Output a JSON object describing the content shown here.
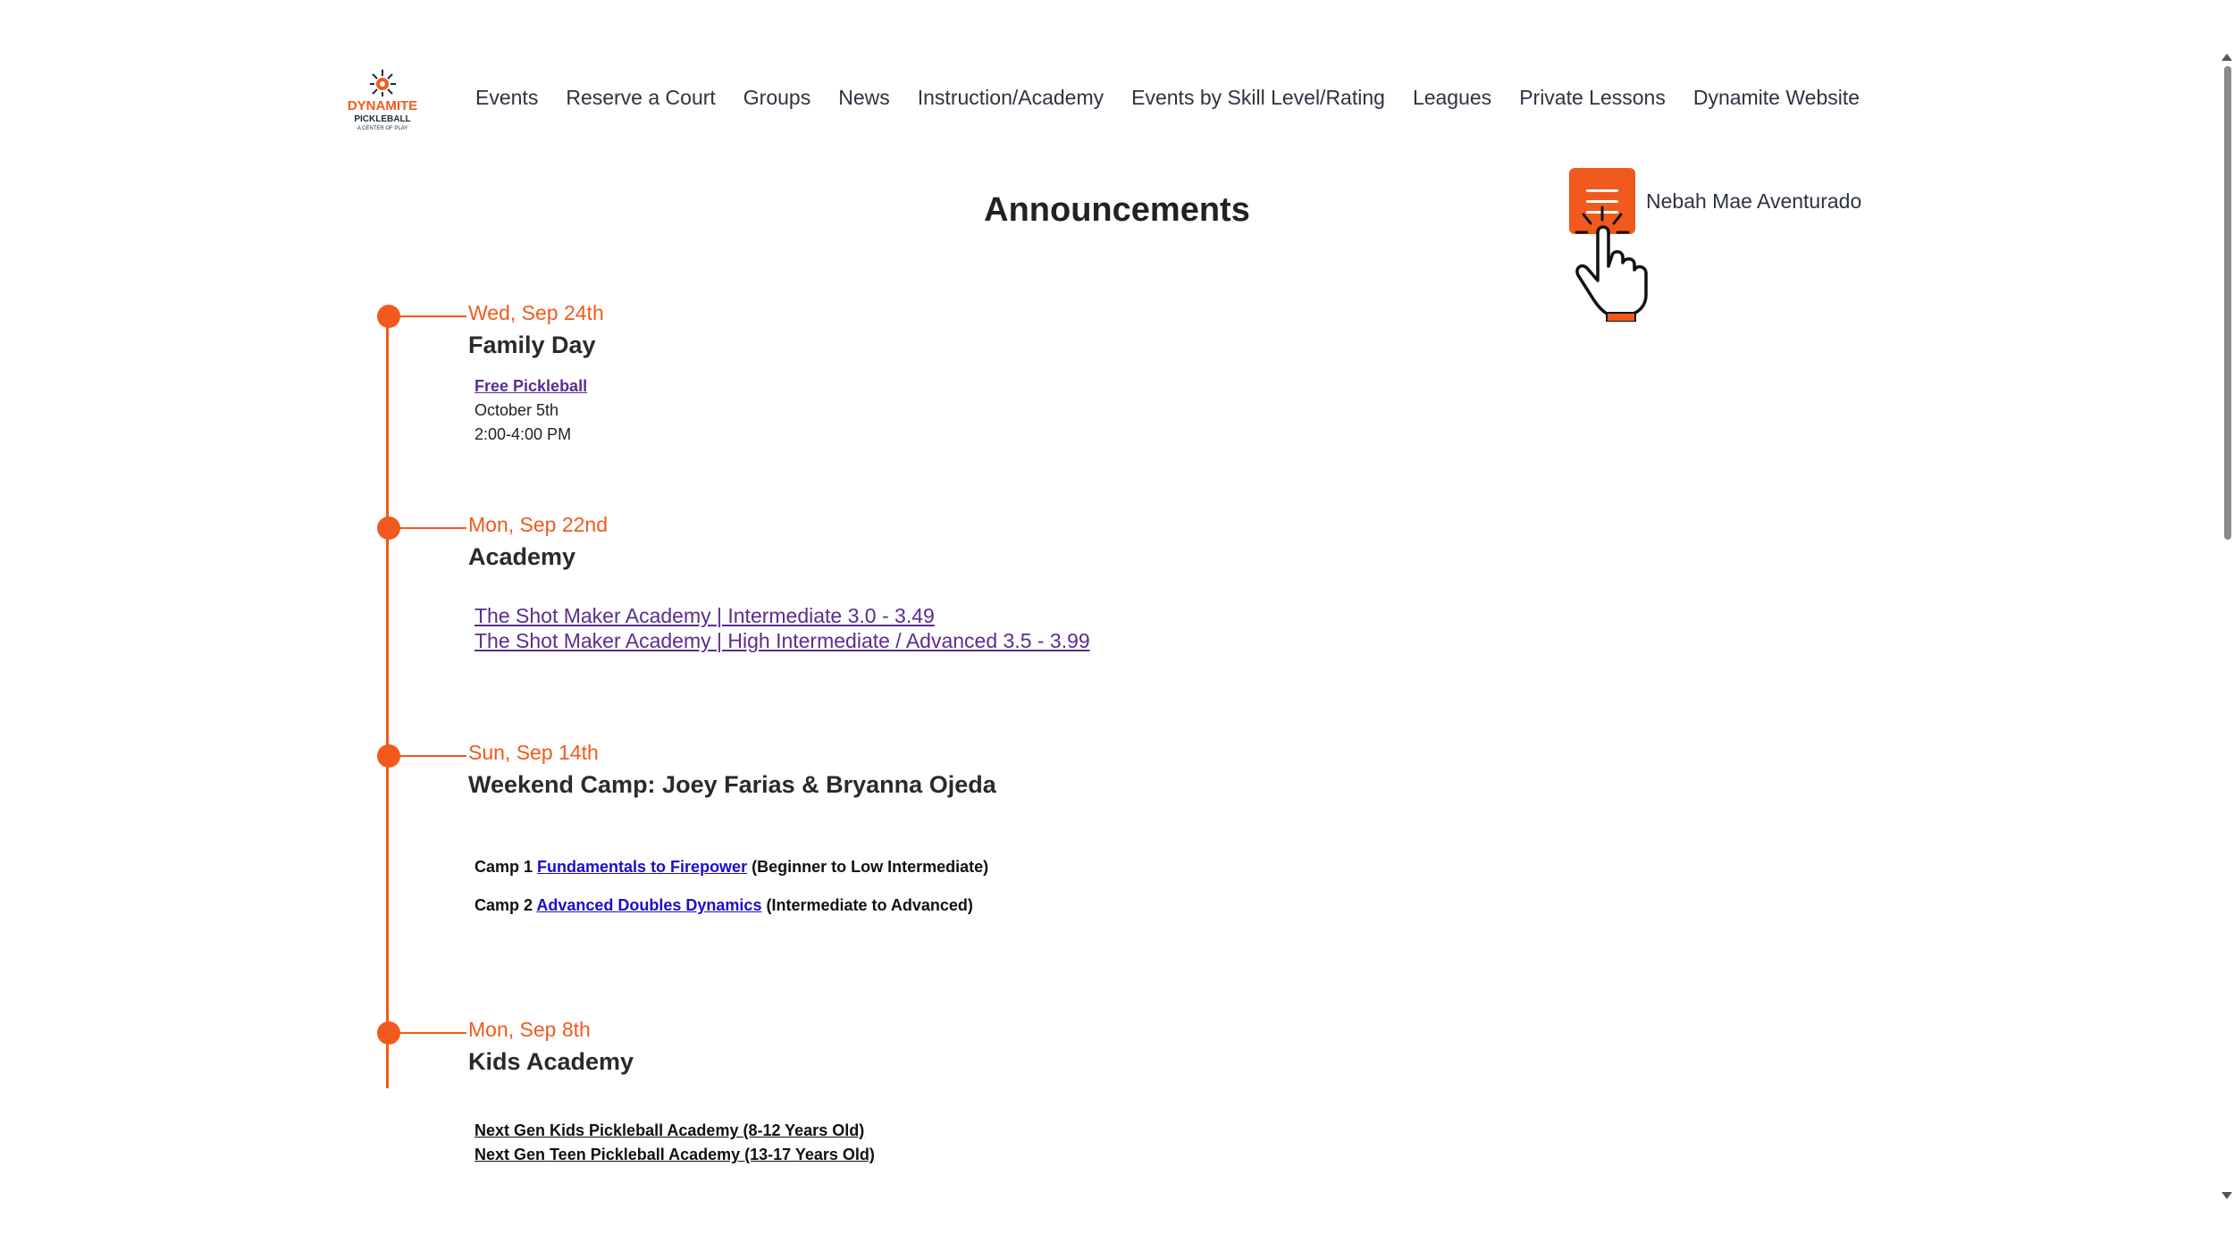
{
  "brand": {
    "logo_line1": "DYNAMITE",
    "logo_line2": "PICKLEBALL",
    "logo_line3": "A CENTER OF PLAY",
    "primary_color": "#f15a1c"
  },
  "nav": {
    "items": [
      {
        "label": "Events"
      },
      {
        "label": "Reserve a Court"
      },
      {
        "label": "Groups"
      },
      {
        "label": "News"
      },
      {
        "label": "Instruction/Academy"
      },
      {
        "label": "Events by Skill Level/Rating"
      },
      {
        "label": "Leagues"
      },
      {
        "label": "Private Lessons"
      },
      {
        "label": "Dynamite Website"
      }
    ]
  },
  "user": {
    "name": "Nebah Mae Aventurado",
    "menu_icon": "hamburger-icon"
  },
  "page": {
    "title": "Announcements"
  },
  "announcements": [
    {
      "date": "Wed, Sep 24th",
      "title": "Family Day",
      "link": "Free Pickleball",
      "line1": "October 5th",
      "line2": "2:00-4:00 PM"
    },
    {
      "date": "Mon, Sep 22nd",
      "title": "Academy",
      "links": [
        "The Shot Maker Academy | Intermediate 3.0 - 3.49",
        "The Shot Maker Academy | High Intermediate / Advanced 3.5 - 3.99"
      ]
    },
    {
      "date": "Sun, Sep 14th",
      "title": "Weekend Camp: Joey Farias & Bryanna Ojeda",
      "camps": [
        {
          "prefix": "Camp 1",
          "link": "Fundamentals to Firepower",
          "suffix": "(Beginner to Low Intermediate)"
        },
        {
          "prefix": "Camp 2",
          "link": "Advanced Doubles Dynamics",
          "suffix": "(Intermediate to Advanced)"
        }
      ]
    },
    {
      "date": "Mon, Sep 8th",
      "title": "Kids Academy",
      "links": [
        "Next Gen Kids Pickleball Academy (8-12 Years Old)",
        "Next Gen Teen Pickleball Academy (13-17 Years Old)"
      ]
    }
  ]
}
